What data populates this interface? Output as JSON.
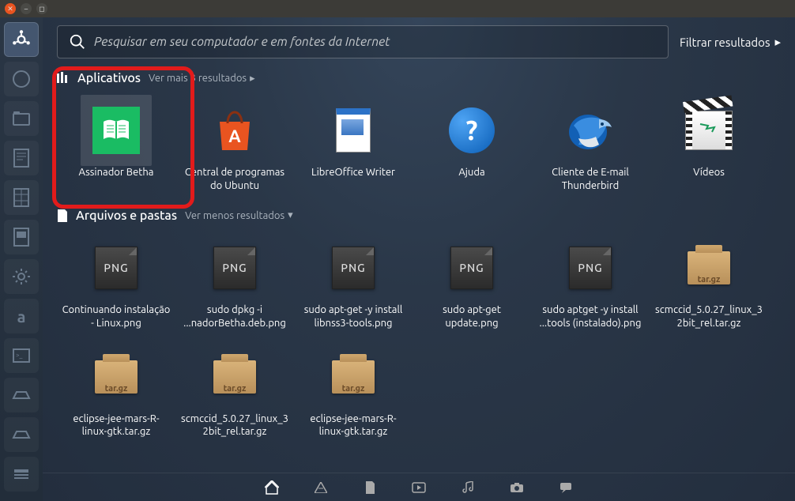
{
  "search": {
    "placeholder": "Pesquisar em seu computador e em fontes da Internet"
  },
  "filter_label": "Filtrar resultados",
  "sections": {
    "apps": {
      "title": "Aplicativos",
      "more": "Ver mais 3 resultados",
      "items": [
        {
          "label": "Assinador Betha",
          "icon": "assinador"
        },
        {
          "label": "Central de programas do Ubuntu",
          "icon": "software-center"
        },
        {
          "label": "LibreOffice Writer",
          "icon": "writer"
        },
        {
          "label": "Ajuda",
          "icon": "help"
        },
        {
          "label": "Cliente de E-mail Thunderbird",
          "icon": "thunderbird"
        },
        {
          "label": "Vídeos",
          "icon": "video"
        }
      ]
    },
    "files": {
      "title": "Arquivos e pastas",
      "more": "Ver menos resultados",
      "items": [
        {
          "label": "Continuando instalação - Linux.png",
          "icon": "png"
        },
        {
          "label": "sudo dpkg -i ...nadorBetha.deb.png",
          "icon": "png"
        },
        {
          "label": "sudo apt-get -y install libnss3-tools.png",
          "icon": "png"
        },
        {
          "label": "sudo apt-get update.png",
          "icon": "png"
        },
        {
          "label": "sudo aptget -y install ...tools (instalado).png",
          "icon": "png"
        },
        {
          "label": "scmccid_5.0.27_linux_32bit_rel.tar.gz",
          "icon": "targz"
        },
        {
          "label": "eclipse-jee-mars-R-linux-gtk.tar.gz",
          "icon": "targz"
        },
        {
          "label": "scmccid_5.0.27_linux_32bit_rel.tar.gz",
          "icon": "targz"
        },
        {
          "label": "eclipse-jee-mars-R-linux-gtk.tar.gz",
          "icon": "targz"
        }
      ]
    }
  },
  "png_text": "PNG",
  "targz_text": "tar.gz",
  "colors": {
    "highlight": "#e21b1b",
    "accent_green": "#1abc63",
    "accent_orange": "#e95420"
  }
}
